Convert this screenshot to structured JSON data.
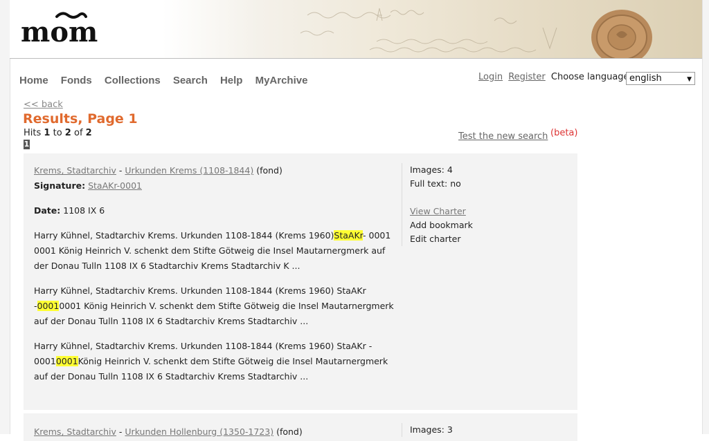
{
  "header": {
    "logo_text": "mom",
    "colors": {
      "accent": "#e06a2e",
      "nav": "#666666",
      "card_bg": "#f3f3f3",
      "highlight": "#ffff33",
      "beta": "#dd3333"
    }
  },
  "nav": {
    "items": [
      {
        "label": "Home"
      },
      {
        "label": "Fonds"
      },
      {
        "label": "Collections"
      },
      {
        "label": "Search"
      },
      {
        "label": "Help"
      },
      {
        "label": "MyArchive"
      }
    ],
    "login": "Login",
    "register": "Register",
    "choose_language": "Choose language:",
    "language_value": "english"
  },
  "page": {
    "back_link": "<< back",
    "title": "Results, Page 1",
    "hits_prefix": "Hits",
    "hits_from": "1",
    "hits_to_word": "to",
    "hits_to": "2",
    "hits_of_word": "of",
    "hits_total": "2",
    "current_page": "1",
    "new_search_link": "Test the new search",
    "beta_label": "(beta)"
  },
  "results": [
    {
      "archive": "Krems, Stadtarchiv",
      "separator": "-",
      "fond": "Urkunden Krems (1108-1844)",
      "fond_suffix": "(fond)",
      "signature_label": "Signature:",
      "signature": "StaAKr-0001",
      "date_label": "Date:",
      "date": "1108 IX 6",
      "snippets": [
        {
          "pre": "Harry Kühnel, Stadtarchiv Krems. Urkunden 1108-1844 (Krems 1960)",
          "hit": "StaAKr",
          "post": "- 0001 0001 König Heinrich V. schenkt dem Stifte Götweig die Insel Mautarnergmerk auf der Donau Tulln 1108 IX 6 Stadtarchiv Krems Stadtarchiv K ..."
        },
        {
          "pre": "Harry Kühnel, Stadtarchiv Krems. Urkunden 1108-1844 (Krems 1960) StaAKr -",
          "hit": "0001",
          "post": "0001 König Heinrich V. schenkt dem Stifte Götweig die Insel Mautarnergmerk auf der Donau Tulln 1108 IX 6 Stadtarchiv Krems Stadtarchiv ..."
        },
        {
          "pre": "Harry Kühnel, Stadtarchiv Krems. Urkunden 1108-1844 (Krems 1960) StaAKr - 0001",
          "hit": "0001",
          "post": "König Heinrich V. schenkt dem Stifte Götweig die Insel Mautarnergmerk auf der Donau Tulln 1108 IX 6 Stadtarchiv Krems Stadtarchiv ..."
        }
      ],
      "images": "Images: 4",
      "fulltext": "Full text: no",
      "view_charter": "View Charter",
      "add_bookmark": "Add bookmark",
      "edit_charter": "Edit charter"
    },
    {
      "archive": "Krems, Stadtarchiv",
      "separator": "-",
      "fond": "Urkunden Hollenburg (1350-1723)",
      "fond_suffix": "(fond)",
      "images": "Images: 3"
    }
  ]
}
